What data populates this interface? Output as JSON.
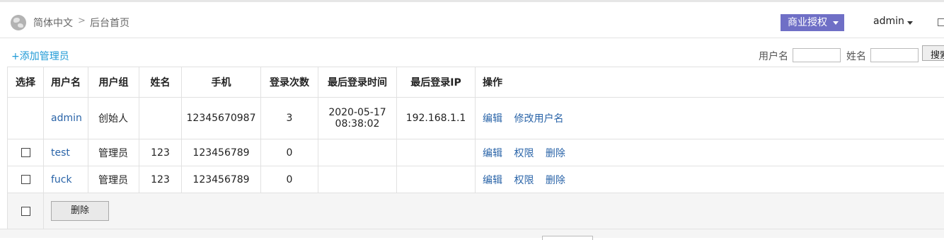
{
  "header": {
    "language": "简体中文",
    "separator": ">",
    "breadcrumb_home": "后台首页",
    "license_button": "商业授权",
    "user": "admin"
  },
  "toolbar": {
    "add_admin": "+添加管理员",
    "username_label": "用户名",
    "username_value": "",
    "name_label": "姓名",
    "name_value": "",
    "search_button": "搜索"
  },
  "table": {
    "columns": [
      "选择",
      "用户名",
      "用户组",
      "姓名",
      "手机",
      "登录次数",
      "最后登录时间",
      "最后登录IP",
      "操作"
    ],
    "rows": [
      {
        "checkbox": false,
        "username": "admin",
        "group": "创始人",
        "name": "",
        "phone": "12345670987",
        "login_count": "3",
        "last_login_date": "2020-05-17",
        "last_login_clock": "08:38:02",
        "last_ip": "192.168.1.1",
        "actions": [
          "编辑",
          "修改用户名"
        ]
      },
      {
        "checkbox": true,
        "username": "test",
        "group": "管理员",
        "name": "123",
        "phone": "123456789",
        "login_count": "0",
        "last_login_date": "",
        "last_login_clock": "",
        "last_ip": "",
        "actions": [
          "编辑",
          "权限",
          "删除"
        ]
      },
      {
        "checkbox": true,
        "username": "fuck",
        "group": "管理员",
        "name": "123",
        "phone": "123456789",
        "login_count": "0",
        "last_login_date": "",
        "last_login_clock": "",
        "last_ip": "",
        "actions": [
          "编辑",
          "权限",
          "删除"
        ]
      }
    ],
    "bulk_delete": "删除"
  },
  "colors": {
    "accent_link": "#2a64a8",
    "add_link": "#1f9ad6",
    "license_button_bg": "#6f6fc6"
  }
}
